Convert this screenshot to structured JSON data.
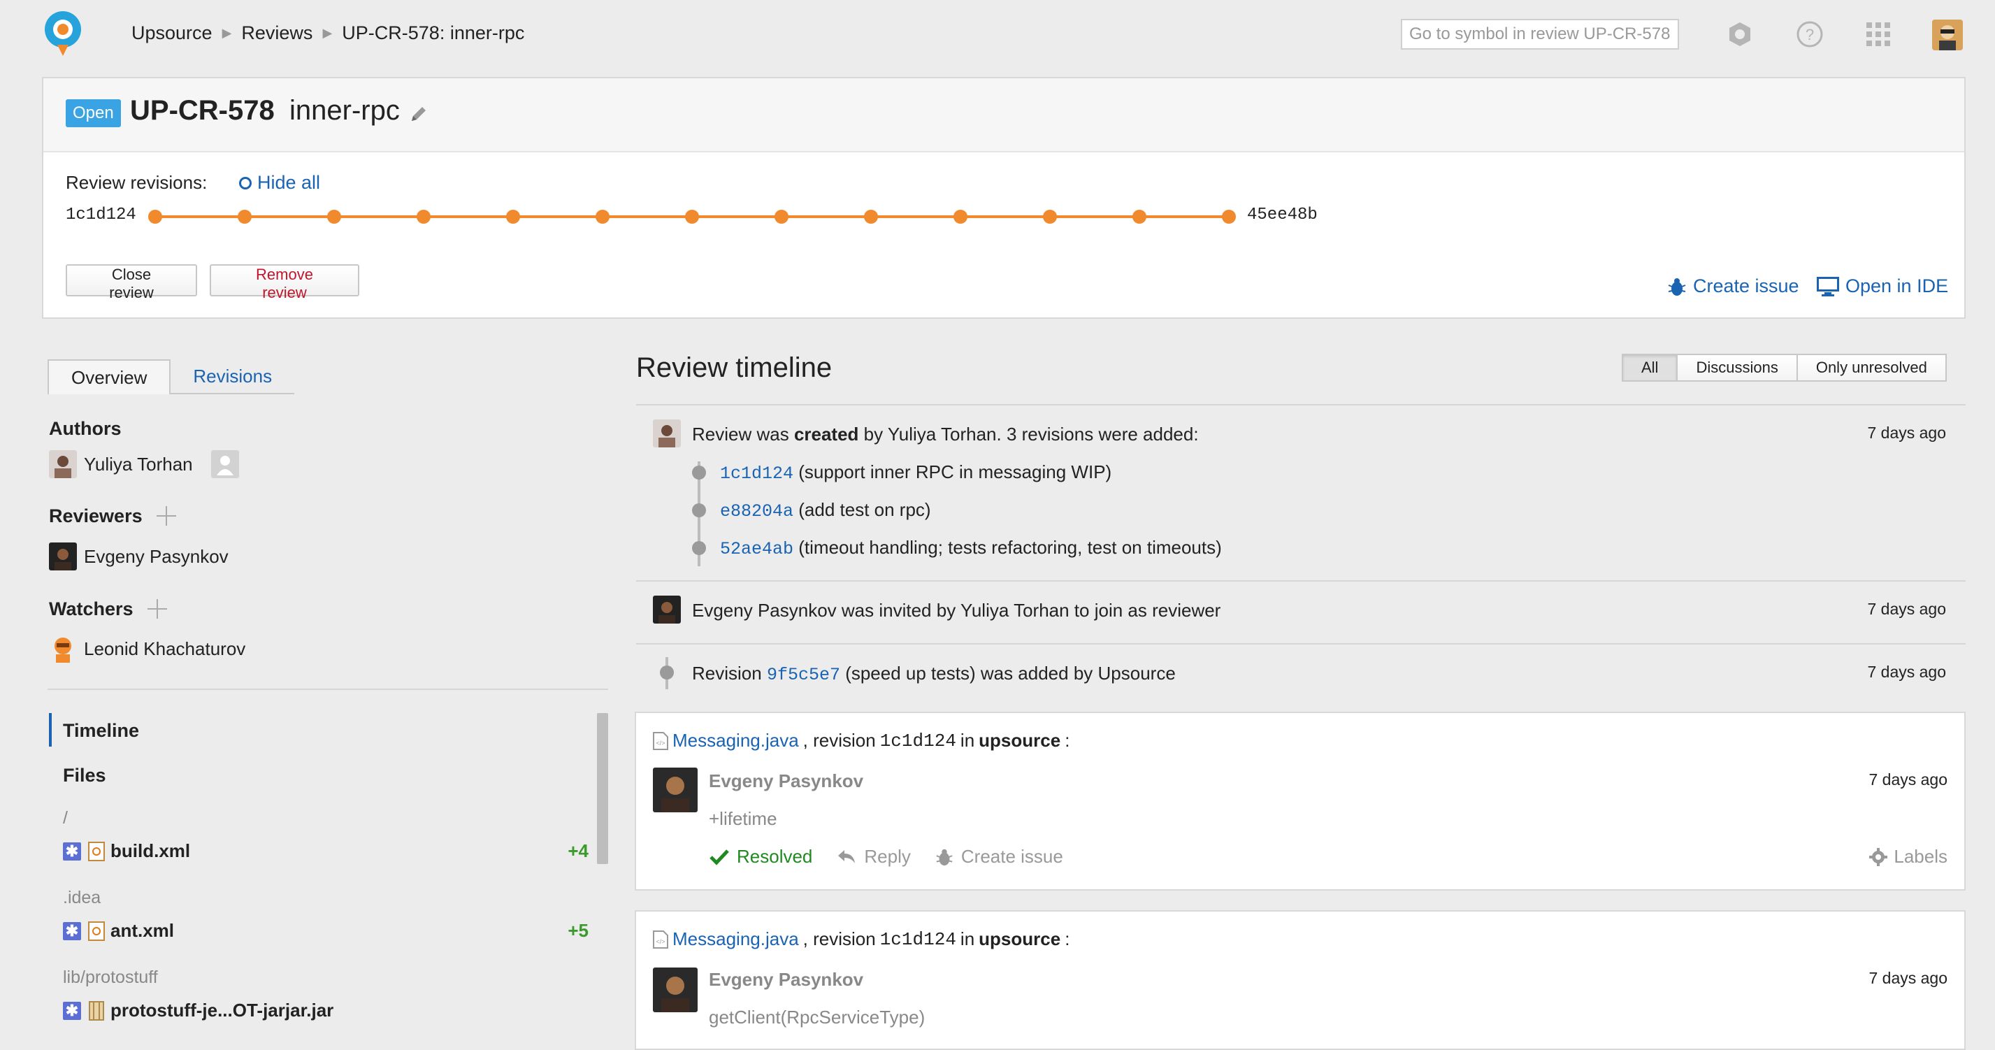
{
  "breadcrumb": [
    "Upsource",
    "Reviews",
    "UP-CR-578: inner-rpc"
  ],
  "search": {
    "placeholder": "Go to symbol in review UP-CR-578"
  },
  "review": {
    "status": "Open",
    "id": "UP-CR-578",
    "name": "inner-rpc",
    "revisions_label": "Review revisions:",
    "hide_all": "Hide all",
    "first_revision": "1c1d124",
    "last_revision": "45ee48b",
    "revision_count": 13,
    "close_label": "Close review",
    "remove_label": "Remove review",
    "create_issue": "Create issue",
    "open_ide": "Open in IDE"
  },
  "colors": {
    "accent": "#1a63b3",
    "revision_line": "#f08a2c",
    "open_badge": "#3aa3e3",
    "resolved": "#1f8a1f",
    "added": "#3b9a2c"
  },
  "left": {
    "tabs": [
      "Overview",
      "Revisions"
    ],
    "authors_label": "Authors",
    "authors": [
      "Yuliya Torhan"
    ],
    "reviewers_label": "Reviewers",
    "reviewers": [
      "Evgeny Pasynkov"
    ],
    "watchers_label": "Watchers",
    "watchers": [
      "Leonid Khachaturov"
    ],
    "nav": [
      "Timeline",
      "Files"
    ],
    "files": [
      {
        "dir": "/",
        "name": "build.xml",
        "count": "+4"
      },
      {
        "dir": ".idea",
        "name": "ant.xml",
        "count": "+5"
      },
      {
        "dir": "lib/protostuff",
        "name": "protostuff-je...OT-jarjar.jar",
        "count": ""
      }
    ]
  },
  "timeline": {
    "title": "Review timeline",
    "filters": [
      "All",
      "Discussions",
      "Only unresolved"
    ],
    "created": {
      "pre": "Review was ",
      "bold": "created",
      "post": " by Yuliya Torhan. 3 revisions were added:",
      "time": "7 days ago",
      "commits": [
        {
          "hash": "1c1d124",
          "msg": " (support inner RPC in messaging WIP)"
        },
        {
          "hash": "e88204a",
          "msg": " (add test on rpc)"
        },
        {
          "hash": "52ae4ab",
          "msg": " (timeout handling; tests refactoring, test on timeouts)"
        }
      ]
    },
    "invited": {
      "text": "Evgeny Pasynkov was invited by Yuliya Torhan to join as reviewer",
      "time": "7 days ago"
    },
    "revision_added": {
      "pre": "Revision ",
      "hash": "9f5c5e7",
      "post": " (speed up tests) was added by Upsource",
      "time": "7 days ago"
    },
    "discussions": [
      {
        "file": "Messaging.java",
        "mid": ", revision ",
        "rev": "1c1d124",
        "in": " in ",
        "project": "upsource",
        "colon": ":",
        "author": "Evgeny Pasynkov",
        "time": "7 days ago",
        "body": "+lifetime",
        "resolved": "Resolved",
        "reply": "Reply",
        "create_issue": "Create issue",
        "labels": "Labels"
      },
      {
        "file": "Messaging.java",
        "mid": ", revision ",
        "rev": "1c1d124",
        "in": " in ",
        "project": "upsource",
        "colon": ":",
        "author": "Evgeny Pasynkov",
        "time": "7 days ago",
        "body": "getClient(RpcServiceType)"
      }
    ]
  }
}
